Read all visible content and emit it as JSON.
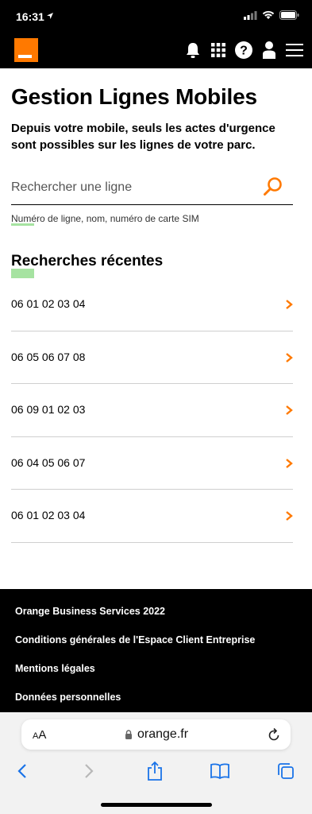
{
  "status_bar": {
    "time": "16:31",
    "icons": [
      "location-arrow-icon",
      "signal-icon",
      "wifi-icon",
      "battery-icon"
    ]
  },
  "header": {
    "logo": "orange-logo",
    "icons": [
      "bell-icon",
      "grid-icon",
      "help-icon",
      "user-icon",
      "menu-icon"
    ]
  },
  "main": {
    "title": "Gestion Lignes Mobiles",
    "subtitle": "Depuis votre mobile, seuls les actes d'urgence sont possibles sur les lignes de votre parc.",
    "search": {
      "placeholder": "Rechercher une ligne",
      "value": "",
      "hint": "Numéro de ligne, nom, numéro de carte SIM"
    },
    "recent_title": "Recherches récentes",
    "recent_searches": [
      "06 01 02 03 04",
      "06 05 06 07 08",
      "06 09 01 02 03",
      "06 04 05 06 07",
      "06 01 02 03 04"
    ]
  },
  "footer": {
    "links": [
      "Orange Business Services 2022",
      "Conditions générales de l'Espace Client Entreprise",
      "Mentions légales",
      "Données personnelles"
    ]
  },
  "browser": {
    "text_size_label": "AA",
    "url": "orange.fr",
    "toolbar": [
      "back-icon",
      "forward-icon",
      "share-icon",
      "bookmarks-icon",
      "tabs-icon"
    ]
  },
  "colors": {
    "brand": "#ff7900",
    "header_bg": "#000000",
    "highlight": "#a6e3a1"
  }
}
